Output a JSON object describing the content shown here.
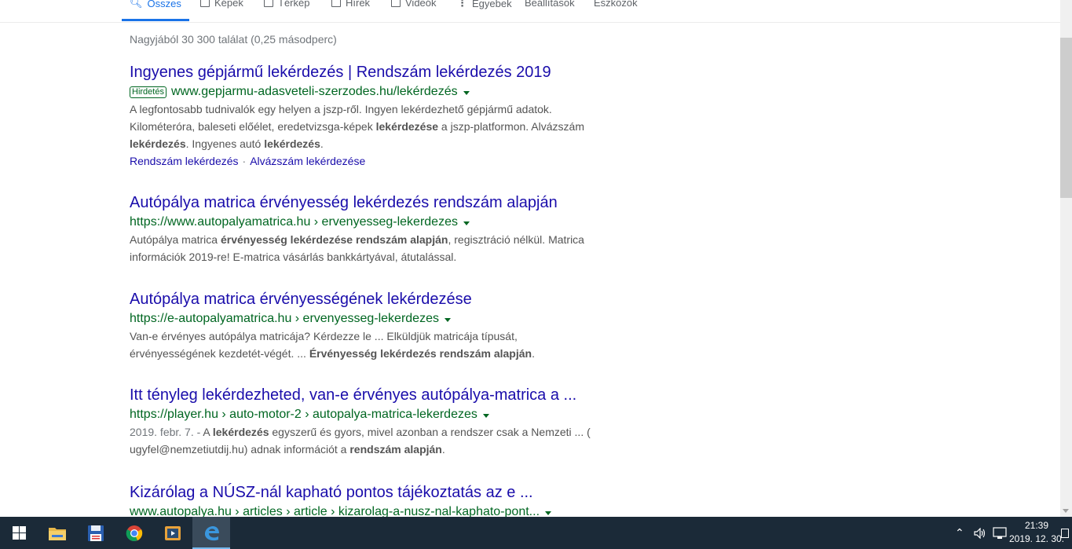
{
  "tabs": [
    {
      "label": "Összes",
      "icon": "search-icon"
    },
    {
      "label": "Képek",
      "icon": "image-icon"
    },
    {
      "label": "Térkép",
      "icon": "map-icon"
    },
    {
      "label": "Hírek",
      "icon": "news-icon"
    },
    {
      "label": "Videók",
      "icon": "video-icon"
    },
    {
      "label": "Egyebek",
      "icon": "more-dots-icon"
    },
    {
      "label": "Beállítások"
    },
    {
      "label": "Eszközök"
    }
  ],
  "stats": "Nagyjából 30 300 találat (0,25 másodperc)",
  "results": [
    {
      "title": "Ingyenes gépjármű lekérdezés | Rendszám lekérdezés 2019",
      "ad_label": "Hirdetés",
      "url": "www.gepjarmu-adasveteli-szerzodes.hu/lekérdezés",
      "snippet_lines": [
        [
          "A legfontosabb tudnivalók egy helyen a jszp-ről. Ingyen lekérdezhető gépjármű adatok."
        ],
        [
          "Kilométeróra, baleseti előélet, eredetvizsga-képek ",
          "lekérdezése",
          " a jszp-platformon. Alvázszám"
        ],
        [
          "lekérdezés",
          ". Ingyenes autó ",
          "lekérdezés",
          "."
        ]
      ],
      "sitelinks": [
        "Rendszám lekérdezés",
        "Alvázszám lekérdezése"
      ]
    },
    {
      "title": "Autópálya matrica érvényesség lekérdezés rendszám alapján",
      "url": "https://www.autopalyamatrica.hu › ervenyesseg-lekerdezes",
      "snippet_lines": [
        [
          "Autópálya matrica ",
          "érvényesség lekérdezése rendszám alapján",
          ", regisztráció nélkül. Matrica"
        ],
        [
          "információk 2019-re! E-matrica vásárlás bankkártyával, átutalással."
        ]
      ]
    },
    {
      "title": "Autópálya matrica érvényességének lekérdezése",
      "url": "https://e-autopalyamatrica.hu › ervenyesseg-lekerdezes",
      "snippet_lines": [
        [
          "Van-e érvényes autópálya matricája? Kérdezze le ... Elküldjük matricája típusát,"
        ],
        [
          "érvényességének kezdetét-végét. ... ",
          "Érvényesség lekérdezés rendszám alapján",
          "."
        ]
      ]
    },
    {
      "title": "Itt tényleg lekérdezheted, van-e érvényes autópálya-matrica a ...",
      "url": "https://player.hu › auto-motor-2 › autopalya-matrica-lekerdezes",
      "date": "2019. febr. 7. - ",
      "snippet_lines": [
        [
          "A ",
          "lekérdezés",
          " egyszerű és gyors, mivel azonban a rendszer csak a Nemzeti ... ("
        ],
        [
          "ugyfel@nemzetiutdij.hu) adnak információt a ",
          "rendszám alapján",
          "."
        ]
      ]
    },
    {
      "title": "Kizárólag a NÚSZ-nál kapható pontos tájékoztatás az e ...",
      "url": "www.autopalya.hu › articles › article › kizarolag-a-nusz-nal-kaphato-pont...",
      "snippet_lines": []
    }
  ],
  "taskbar": {
    "apps": [
      "start-icon",
      "file-explorer-icon",
      "save-floppy-icon",
      "chrome-icon",
      "media-player-icon",
      "edge-icon"
    ],
    "tray_icons": [
      "chevron-up-icon",
      "volume-icon",
      "network-icon",
      "notification-icon"
    ],
    "time": "21:39",
    "date": "2019. 12. 30."
  },
  "colors": {
    "link": "#1a0dab",
    "url_green": "#006621",
    "accent_blue": "#1a73e8",
    "taskbar": "#1b2a38"
  }
}
